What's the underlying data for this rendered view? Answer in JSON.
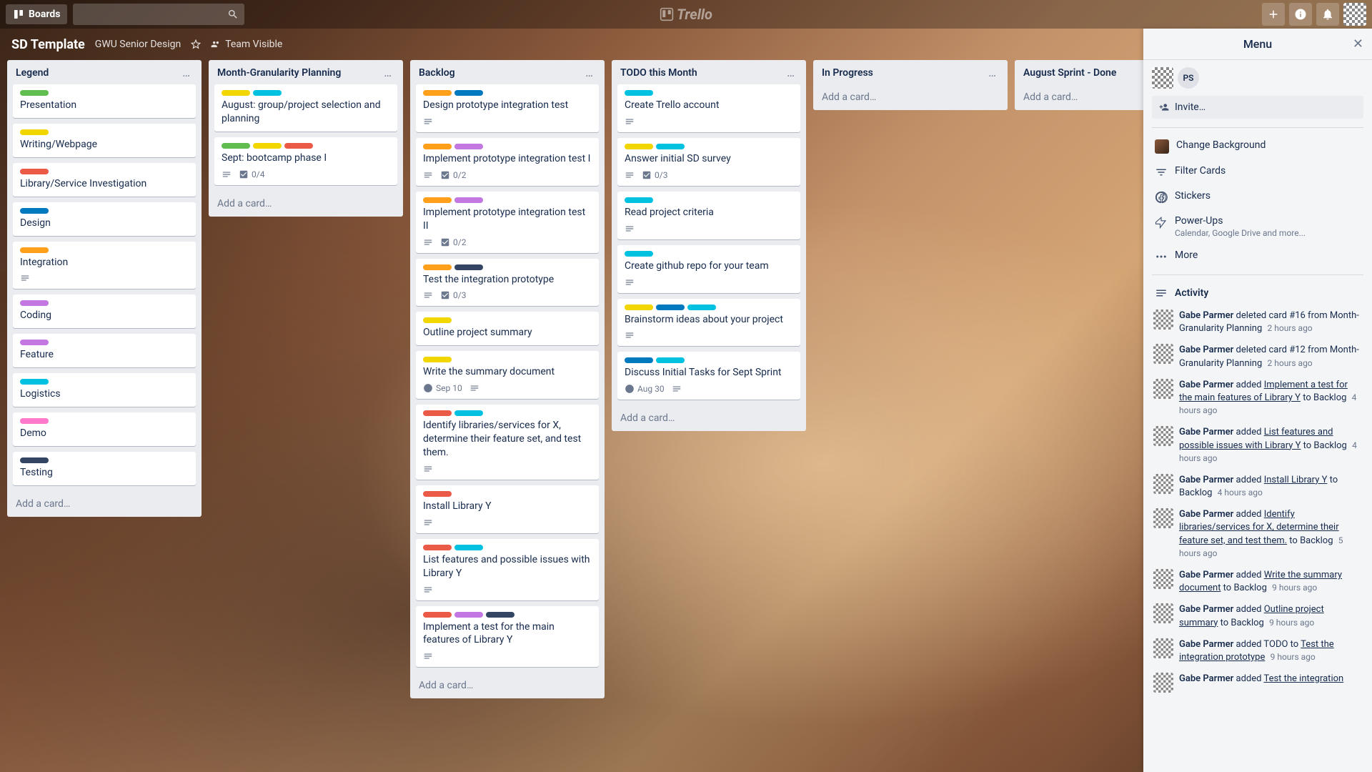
{
  "topbar": {
    "boards": "Boards",
    "logo": "Trello"
  },
  "board": {
    "title": "SD Template",
    "subtitle": "GWU Senior Design",
    "visibility": "Team Visible"
  },
  "colors": {
    "green": "#61bd4f",
    "yellow": "#f2d600",
    "orange": "#ff9f1a",
    "red": "#eb5a46",
    "purple": "#c377e0",
    "blue": "#0079bf",
    "sky": "#00c2e0",
    "pink": "#ff78cb",
    "black": "#344563"
  },
  "lists": [
    {
      "title": "Legend",
      "cards": [
        {
          "labels": [
            "green"
          ],
          "title": "Presentation"
        },
        {
          "labels": [
            "yellow"
          ],
          "title": "Writing/Webpage"
        },
        {
          "labels": [
            "red"
          ],
          "title": "Library/Service Investigation"
        },
        {
          "labels": [
            "blue"
          ],
          "title": "Design"
        },
        {
          "labels": [
            "orange"
          ],
          "title": "Integration",
          "desc": true
        },
        {
          "labels": [
            "purple"
          ],
          "title": "Coding"
        },
        {
          "labels": [
            "purple"
          ],
          "title": "Feature"
        },
        {
          "labels": [
            "sky"
          ],
          "title": "Logistics"
        },
        {
          "labels": [
            "pink"
          ],
          "title": "Demo"
        },
        {
          "labels": [
            "black"
          ],
          "title": "Testing"
        }
      ],
      "addCard": "Add a card…"
    },
    {
      "title": "Month-Granularity Planning",
      "cards": [
        {
          "labels": [
            "yellow",
            "sky"
          ],
          "title": "August: group/project selection and planning"
        },
        {
          "labels": [
            "green",
            "yellow",
            "red"
          ],
          "title": "Sept: bootcamp phase I",
          "desc": true,
          "checklist": "0/4"
        }
      ],
      "addCard": "Add a card…"
    },
    {
      "title": "Backlog",
      "cards": [
        {
          "labels": [
            "orange",
            "blue"
          ],
          "title": "Design prototype integration test",
          "desc": true
        },
        {
          "labels": [
            "orange",
            "purple"
          ],
          "title": "Implement prototype integration test I",
          "desc": true,
          "checklist": "0/2"
        },
        {
          "labels": [
            "orange",
            "purple"
          ],
          "title": "Implement prototype integration test II",
          "desc": true,
          "checklist": "0/2"
        },
        {
          "labels": [
            "orange",
            "black"
          ],
          "title": "Test the integration prototype",
          "desc": true,
          "checklist": "0/3"
        },
        {
          "labels": [
            "yellow"
          ],
          "title": "Outline project summary"
        },
        {
          "labels": [
            "yellow"
          ],
          "title": "Write the summary document",
          "due": "Sep 10",
          "desc": true
        },
        {
          "labels": [
            "red",
            "sky"
          ],
          "title": "Identify libraries/services for X, determine their feature set, and test them.",
          "desc": true
        },
        {
          "labels": [
            "red"
          ],
          "title": "Install Library Y",
          "desc": true
        },
        {
          "labels": [
            "red",
            "sky"
          ],
          "title": "List features and possible issues with Library Y",
          "desc": true
        },
        {
          "labels": [
            "red",
            "purple",
            "black"
          ],
          "title": "Implement a test for the main features of Library Y",
          "desc": true
        }
      ],
      "addCard": "Add a card…"
    },
    {
      "title": "TODO this Month",
      "cards": [
        {
          "labels": [
            "sky"
          ],
          "title": "Create Trello account",
          "desc": true
        },
        {
          "labels": [
            "yellow",
            "sky"
          ],
          "title": "Answer initial SD survey",
          "desc": true,
          "checklist": "0/3"
        },
        {
          "labels": [
            "sky"
          ],
          "title": "Read project criteria",
          "desc": true
        },
        {
          "labels": [
            "sky"
          ],
          "title": "Create github repo for your team",
          "desc": true
        },
        {
          "labels": [
            "yellow",
            "blue",
            "sky"
          ],
          "title": "Brainstorm ideas about your project",
          "desc": true
        },
        {
          "labels": [
            "blue",
            "sky"
          ],
          "title": "Discuss Initial Tasks for Sept Sprint",
          "due": "Aug 30",
          "desc": true
        }
      ],
      "addCard": "Add a card…"
    },
    {
      "title": "In Progress",
      "cards": [],
      "addCard": "Add a card…"
    },
    {
      "title": "August Sprint - Done",
      "cards": [],
      "addCard": "Add a card…"
    }
  ],
  "menu": {
    "title": "Menu",
    "memberInitials": "PS",
    "invite": "Invite…",
    "items": {
      "bg": "Change Background",
      "filter": "Filter Cards",
      "stickers": "Stickers",
      "powerups": "Power-Ups",
      "powerupsSub": "Calendar, Google Drive and more...",
      "more": "More",
      "activity": "Activity"
    },
    "activity": [
      {
        "user": "Gabe Parmer",
        "text": " deleted card #16 from Month-Granularity Planning",
        "time": "2 hours ago"
      },
      {
        "user": "Gabe Parmer",
        "text": " deleted card #12 from Month-Granularity Planning",
        "time": "2 hours ago"
      },
      {
        "user": "Gabe Parmer",
        "text": " added ",
        "link": "Implement a test for the main features of Library Y",
        "after": " to Backlog",
        "time": "4 hours ago"
      },
      {
        "user": "Gabe Parmer",
        "text": " added ",
        "link": "List features and possible issues with Library Y",
        "after": " to Backlog",
        "time": "4 hours ago"
      },
      {
        "user": "Gabe Parmer",
        "text": " added ",
        "link": "Install Library Y",
        "after": " to Backlog",
        "time": "4 hours ago"
      },
      {
        "user": "Gabe Parmer",
        "text": " added ",
        "link": "Identify libraries/services for X, determine their feature set, and test them.",
        "after": " to Backlog",
        "time": "5 hours ago"
      },
      {
        "user": "Gabe Parmer",
        "text": " added ",
        "link": "Write the summary document",
        "after": " to Backlog",
        "time": "9 hours ago"
      },
      {
        "user": "Gabe Parmer",
        "text": " added ",
        "link": "Outline project summary",
        "after": " to Backlog",
        "time": "9 hours ago"
      },
      {
        "user": "Gabe Parmer",
        "text": " added TODO to ",
        "link": "Test the integration prototype",
        "after": "",
        "time": "9 hours ago"
      },
      {
        "user": "Gabe Parmer",
        "text": " added ",
        "link": "Test the integration",
        "after": "",
        "time": ""
      }
    ]
  }
}
